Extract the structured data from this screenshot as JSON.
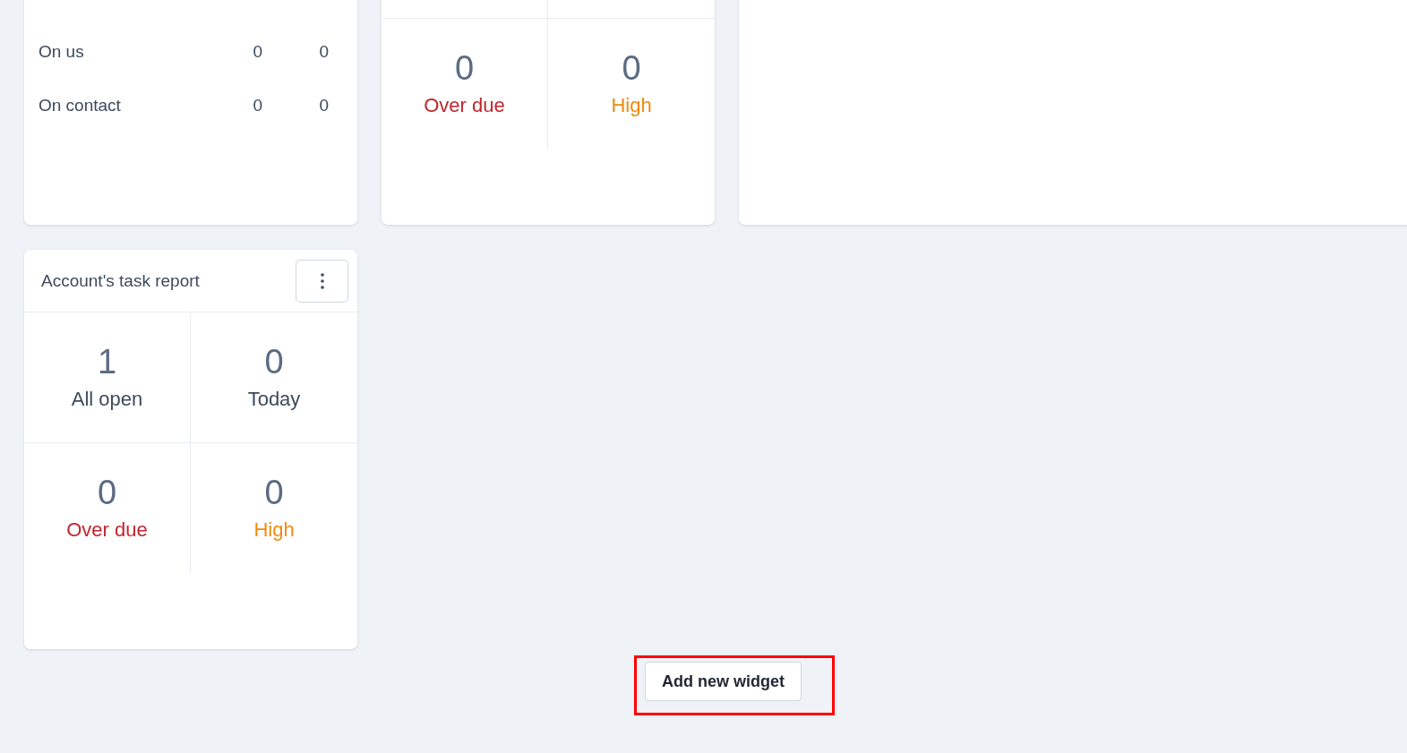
{
  "cards": [
    {
      "kind": "list",
      "rows": [
        {
          "label": "On us",
          "col_1": "0",
          "col_2": "0"
        },
        {
          "label": "On contact",
          "col_1": "0",
          "col_2": "0"
        }
      ]
    },
    {
      "kind": "stats",
      "stats": [
        {
          "value": "0",
          "label": "Over due",
          "color": "#c0262d"
        },
        {
          "value": "0",
          "label": "High",
          "color": "#f08a0b"
        }
      ]
    },
    {
      "kind": "blank"
    },
    {
      "kind": "stats",
      "title": "Account's task report",
      "stats": [
        {
          "value": "1",
          "label": "All open",
          "color": "#3d4a5c"
        },
        {
          "value": "0",
          "label": "Today",
          "color": "#3d4a5c"
        },
        {
          "value": "0",
          "label": "Over due",
          "color": "#c0262d"
        },
        {
          "value": "0",
          "label": "High",
          "color": "#f08a0b"
        }
      ]
    }
  ],
  "add_button": {
    "label": "Add new widget",
    "highlighted": true
  }
}
